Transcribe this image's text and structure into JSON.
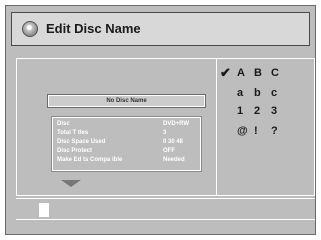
{
  "title": {
    "text": "Edit Disc Name",
    "icon": "disc-icon"
  },
  "disc_name_field": {
    "value": "No Disc Name"
  },
  "disc_info": [
    {
      "label": "Disc",
      "value": "DVD+RW"
    },
    {
      "label": "Total T tles",
      "value": "3"
    },
    {
      "label": "Disc Space Used",
      "value": "0 30 48"
    },
    {
      "label": "Disc Protect",
      "value": "OFF"
    },
    {
      "label": "Make Ed ts Compa ible",
      "value": "Needed"
    }
  ],
  "character_sets": {
    "selected_marker": "✔",
    "rows": [
      [
        "A",
        "B",
        "C"
      ],
      [
        "a",
        "b",
        "c"
      ],
      [
        "1",
        "2",
        "3"
      ],
      [
        "@",
        "!",
        "?"
      ]
    ]
  },
  "input": {
    "value": ""
  }
}
